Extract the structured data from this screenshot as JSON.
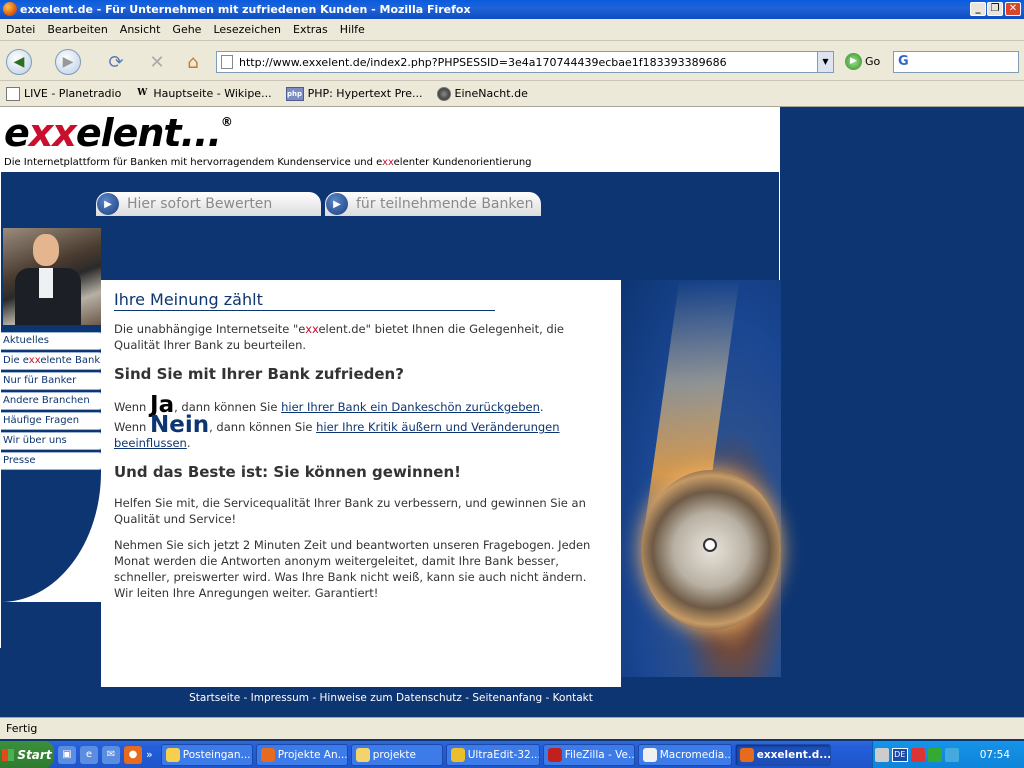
{
  "window": {
    "title": "exxelent.de - Für Unternehmen mit zufriedenen Kunden - Mozilla Firefox",
    "minimize": "_",
    "maximize": "❐",
    "close": "✕"
  },
  "menu": [
    "Datei",
    "Bearbeiten",
    "Ansicht",
    "Gehe",
    "Lesezeichen",
    "Extras",
    "Hilfe"
  ],
  "navigation": {
    "url": "http://www.exxelent.de/index2.php?PHPSESSID=3e4a170744439ecbae1f183393389686",
    "go_label": "Go",
    "search_placeholder": "G"
  },
  "bookmarks": [
    {
      "label": "LIVE - Planetradio",
      "icon": "page-icon"
    },
    {
      "label": "Hauptseite - Wikipe...",
      "icon": "wikipedia-icon",
      "glyph": "W"
    },
    {
      "label": "PHP: Hypertext Pre...",
      "icon": "php-icon",
      "glyph": "php"
    },
    {
      "label": "EineNacht.de",
      "icon": "globe-icon"
    }
  ],
  "site": {
    "logo_prefix": "e",
    "logo_xx": "xx",
    "logo_suffix": "elent...",
    "logo_reg": "®",
    "tagline_before": "Die Internetplattform für Banken mit hervorragendem Kundenservice und e",
    "tagline_xx": "xx",
    "tagline_after": "elenter Kundenorientierung",
    "tab1": "Hier sofort Bewerten",
    "tab2": "für teilnehmende Banken",
    "nav": [
      {
        "label": "Aktuelles"
      },
      {
        "label": "Die exxelente Bank",
        "before": "Die e",
        "xx": "xx",
        "after": "elente Bank"
      },
      {
        "label": "Nur für Banker"
      },
      {
        "label": "Andere Branchen"
      },
      {
        "label": "Häufige Fragen"
      },
      {
        "label": "Wir über uns"
      },
      {
        "label": "Presse"
      }
    ],
    "main": {
      "heading": "Ihre Meinung zählt",
      "intro_before": "Die unabhängige Internetseite \"e",
      "intro_xx": "xx",
      "intro_after": "elent.de\" bietet Ihnen die Gelegenheit, die Qualität Ihrer Bank zu beurteilen.",
      "question": "Sind Sie mit Ihrer Bank zufrieden?",
      "ja_prefix": "Wenn ",
      "ja_word": "Ja",
      "ja_middle": ", dann können Sie ",
      "ja_link": "hier Ihrer Bank ein Dankeschön zurückgeben",
      "ja_end": ".",
      "nein_prefix": "Wenn ",
      "nein_word": "Nein",
      "nein_middle": ", dann können Sie ",
      "nein_link": "hier Ihre Kritik äußern und Veränderungen beeinflussen",
      "nein_end": ".",
      "subheading": "Und das Beste ist: Sie können gewinnen!",
      "para1": "Helfen Sie mit, die Servicequalität Ihrer Bank zu verbessern, und gewinnen Sie an Qualität und Service!",
      "para2": "Nehmen Sie sich jetzt 2 Minuten Zeit und beantworten unseren Fragebogen. Jeden Monat werden die Antworten anonym weitergeleitet, damit Ihre Bank besser, schneller, preiswerter wird. Was Ihre Bank nicht weiß, kann sie auch nicht ändern. Wir leiten Ihre Anregungen weiter. Garantiert!"
    },
    "footer": [
      "Startseite",
      "Impressum",
      "Hinweise zum Datenschutz",
      "Seitenanfang",
      "Kontakt"
    ],
    "footer_sep": " - "
  },
  "status": "Fertig",
  "taskbar": {
    "start": "Start",
    "tasks": [
      {
        "label": "Posteingan..."
      },
      {
        "label": "Projekte An..."
      },
      {
        "label": "projekte"
      },
      {
        "label": "UltraEdit-32..."
      },
      {
        "label": "FileZilla - Ve..."
      },
      {
        "label": "Macromedia..."
      },
      {
        "label": "exxelent.d...",
        "active": true
      }
    ],
    "lang": "DE",
    "clock": "07:54"
  },
  "colors": {
    "brand_blue": "#0d3572",
    "accent_red": "#c8102e"
  }
}
